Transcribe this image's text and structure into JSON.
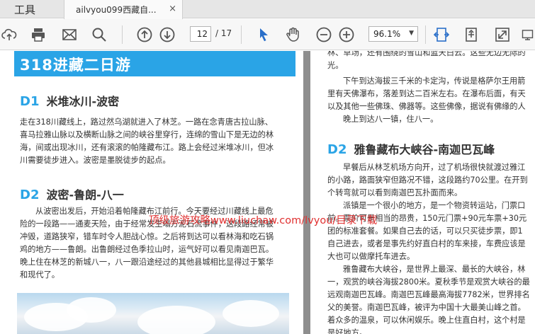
{
  "tabs": {
    "tools": "工具",
    "document": "ailvyou099西藏自...",
    "close": "×"
  },
  "toolbar": {
    "page_current": "12",
    "page_total": "/ 17",
    "zoom": "96.1%",
    "zoom_caret": "▼"
  },
  "page_left": {
    "banner": "318进藏二日游",
    "d1": {
      "num": "D1",
      "title": "米堆冰川-波密"
    },
    "d1_lines": [
      "走在318川藏线上，路过然乌湖就进入了林芝。一路在念青唐古拉山脉、",
      "喜马拉雅山脉以及横断山脉之间的峡谷里穿行，连绵的雪山下是无边的林",
      "海，间或出现冰川，还有滚滚的帕隆藏布江。路上会经过米堆冰川，但冰",
      "川需要徒步进入。波密是墨脱徒步的起点。"
    ],
    "d2": {
      "num": "D2",
      "title": "波密-鲁朗-八一"
    },
    "d2_lines": [
      "从波密出发后，开始沿着帕隆藏布江前行。今天要经过川藏线上最危",
      "险的一段路——通麦天险，由于经常发生塌方泥石流事件，这段路经常被",
      "冲毁，道路狭窄，错车时令人胆战心惊。之后将到达可以看林海和吃石锅",
      "鸡的地方——鲁朗。出鲁朗经过色季拉山时，运气好可以看见南迦巴瓦。",
      "晚上住在林芝的新城八一，八一跟沿途经过的其他县城相比显得过于繁华",
      "和现代了。"
    ]
  },
  "page_right": {
    "top_lines": [
      "林、草场，还有围绕的雪山和蓝天白云。这些无边无际的",
      "光。"
    ],
    "mid_lines": [
      "下午到达海拔三千米的卡定沟，传说是格萨尔王用箭",
      "里有天佛瀑布，落差到达二百米左右。在瀑布后面，有天",
      "以及其他一些佛珠、佛器等。这些佛像，据说有佛缘的人",
      "晚上到达八一镇，住八一。"
    ],
    "d2": {
      "num": "D2",
      "title": "雅鲁藏布大峡谷-南迦巴瓦峰"
    },
    "d2_lines": [
      "早餐后从林芝机场方向开，过了机场很快就渡过雅江",
      "的小路，路面狭窄但路况不错，这段路约70公里。在开到",
      "个转弯就可以看到南迦巴瓦扑面而来。",
      "派镇是一个很小的地方，是一个物资转运站，门票口",
      "前。票价可是相当的昂贵，150元门票+90元车票+30元",
      "团的标准套餐。如果自己去的话，可以只买徒步票，即1",
      "自己进去，或者是事先约好直白村的车来接，车费应该是",
      "大也可以做摩托车进去。",
      "雅鲁藏布大峡谷，是世界上最深、最长的大峡谷，林",
      "一，观赏的峡谷海拔2800米。夏秋季节是观赏大峡谷的最",
      "远观南迦巴瓦峰。南迦巴瓦峰最高海拔7782米，世界排名",
      "父的美誉。南迦巴瓦峰，被评为中国十大最美山峰之首。",
      "着众多的温泉，可以休闲娱乐。晚上住直白村，这个村是",
      "是好地方。"
    ]
  },
  "watermark": "顶级旅游攻略www.liuchaw.com/lvyou/目录下载",
  "colors": {
    "accent": "#2aa4e6",
    "watermark": "#e03030",
    "toolbar_bg": "#f7f7f7",
    "viewer_bg": "#8e8e8e"
  },
  "icons": [
    "upload-icon",
    "print-icon",
    "mail-icon",
    "search-icon",
    "prev-page-icon",
    "next-page-icon",
    "select-arrow-icon",
    "hand-tool-icon",
    "zoom-out-icon",
    "zoom-in-icon",
    "fit-width-icon",
    "rotate-page-icon",
    "fullscreen-icon",
    "more-tools-icon"
  ]
}
